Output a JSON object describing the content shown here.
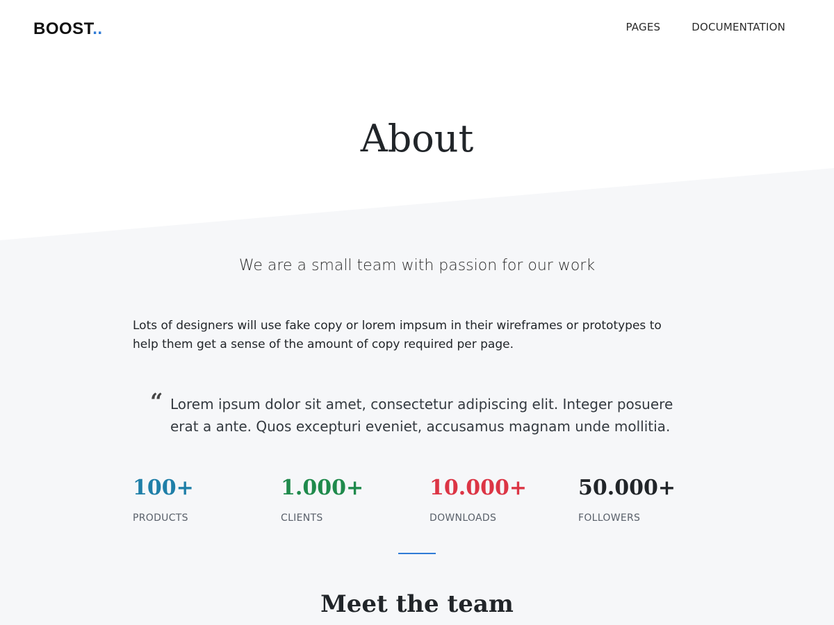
{
  "navbar": {
    "brand": "BOOST",
    "brand_dots": "..",
    "links": [
      {
        "label": "PAGES"
      },
      {
        "label": "DOCUMENTATION"
      }
    ]
  },
  "hero": {
    "title": "About"
  },
  "content": {
    "lead": "We are a small team with passion for our work",
    "body": "Lots of designers will use fake copy or lorem impsum in their wireframes or prototypes to help them get a sense of the amount of copy required per page.",
    "quote": "Lorem ipsum dolor sit amet, consectetur adipiscing elit. Integer posuere erat a ante. Quos excepturi eveniet, accusamus magnam unde mollitia."
  },
  "stats": [
    {
      "value": "100+",
      "label": "PRODUCTS",
      "color": "#1f7fa8"
    },
    {
      "value": "1.000+",
      "label": "CLIENTS",
      "color": "#1f8a4c"
    },
    {
      "value": "10.000+",
      "label": "DOWNLOADS",
      "color": "#dc3545"
    },
    {
      "value": "50.000+",
      "label": "FOLLOWERS",
      "color": "#212529"
    }
  ],
  "team": {
    "title": "Meet the team"
  },
  "colors": {
    "accent": "#2f7bd6",
    "section_bg": "#f6f7f9"
  }
}
